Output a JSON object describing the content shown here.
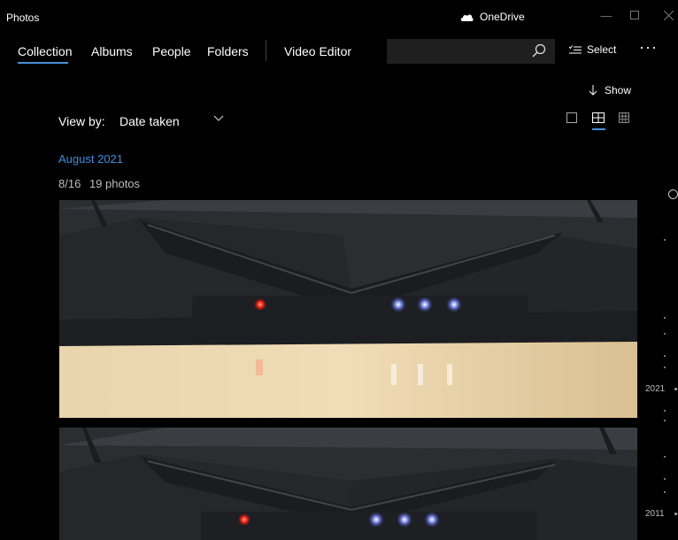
{
  "app": {
    "title": "Photos",
    "onedrive_label": "OneDrive"
  },
  "nav": {
    "tabs": [
      "Collection",
      "Albums",
      "People",
      "Folders",
      "Video Editor"
    ]
  },
  "toolbar": {
    "select_label": "Select",
    "more_label": "···",
    "show_label": "Show"
  },
  "search": {
    "placeholder": ""
  },
  "viewby": {
    "label": "View by:",
    "value": "Date taken"
  },
  "collection": {
    "month": "August 2021",
    "date": "8/16",
    "count": "19 photos"
  },
  "timeline": {
    "years": [
      "2021",
      "2011"
    ]
  },
  "colors": {
    "accent": "#3b8ee0",
    "background": "#000000",
    "search_bg": "#1f1f1f"
  },
  "icons": [
    "onedrive-cloud-icon",
    "minimize-icon",
    "maximize-icon",
    "close-icon",
    "search-icon",
    "select-icon",
    "more-icon",
    "arrow-down-icon",
    "chevron-down-icon",
    "large-tiles-icon",
    "medium-tiles-icon",
    "small-tiles-icon"
  ]
}
